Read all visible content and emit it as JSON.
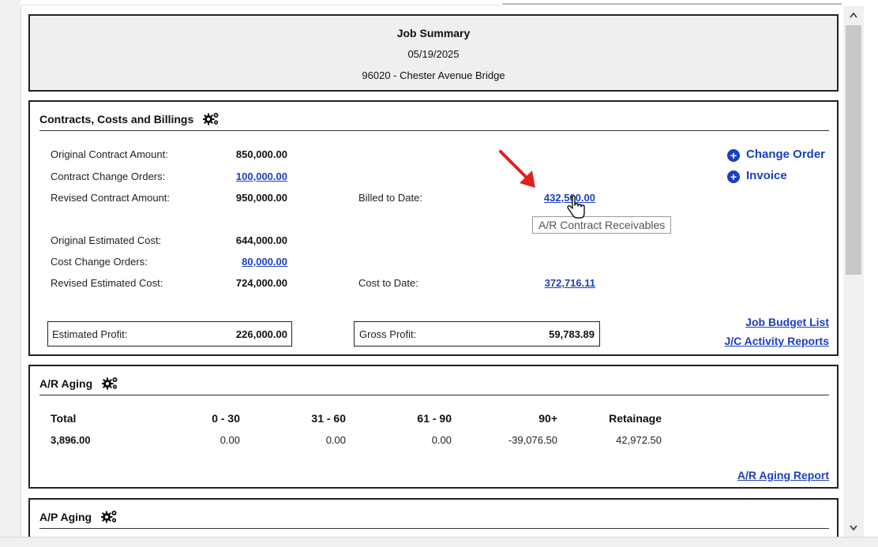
{
  "summary": {
    "title": "Job Summary",
    "date": "05/19/2025",
    "job": "96020 - Chester Avenue Bridge"
  },
  "contracts": {
    "title": "Contracts, Costs and Billings",
    "gear_icon": "gears-icon",
    "original_contract_label": "Original Contract Amount:",
    "original_contract_value": "850,000.00",
    "contract_change_orders_label": "Contract Change Orders:",
    "contract_change_orders_value": "100,000.00",
    "revised_contract_label": "Revised Contract Amount:",
    "revised_contract_value": "950,000.00",
    "billed_label": "Billed to Date:",
    "billed_value": "432,500.00",
    "original_cost_label": "Original Estimated Cost:",
    "original_cost_value": "644,000.00",
    "cost_change_orders_label": "Cost Change Orders:",
    "cost_change_orders_value": "80,000.00",
    "revised_cost_label": "Revised Estimated Cost:",
    "revised_cost_value": "724,000.00",
    "cost_to_date_label": "Cost to Date:",
    "cost_to_date_value": "372,716.11",
    "estimated_profit_label": "Estimated Profit:",
    "estimated_profit_value": "226,000.00",
    "gross_profit_label": "Gross Profit:",
    "gross_profit_value": "59,783.89",
    "change_order_action": "Change Order",
    "invoice_action": "Invoice",
    "job_budget_link": "Job Budget List",
    "jc_activity_link": "J/C Activity Reports",
    "tooltip": "A/R Contract Receivables"
  },
  "ar_aging": {
    "title": "A/R Aging",
    "headers": [
      "Total",
      "0 - 30",
      "31 - 60",
      "61 - 90",
      "90+",
      "Retainage"
    ],
    "values": [
      "3,896.00",
      "0.00",
      "0.00",
      "0.00",
      "-39,076.50",
      "42,972.50"
    ],
    "report_link": "A/R Aging Report"
  },
  "ap_aging": {
    "title": "A/P Aging"
  },
  "colors": {
    "link": "#1a3fc4",
    "arrow": "#e02020"
  }
}
